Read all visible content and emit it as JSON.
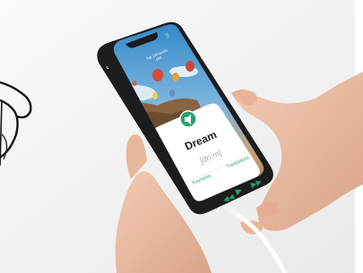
{
  "app": {
    "title_line": "Top 100 words",
    "subtitle_line": "100"
  },
  "card": {
    "word": "Dream",
    "phonetic": "[driːm]",
    "tabs": [
      {
        "label": "Examples"
      },
      {
        "label": "Translations"
      }
    ]
  },
  "player": {
    "prev_icon": "rewind-icon",
    "play_icon": "play-icon",
    "next_icon": "fast-forward-icon"
  },
  "colors": {
    "accent": "#1ea36a",
    "background": "#f3f3f3",
    "phone_body": "#1c1c1e"
  }
}
